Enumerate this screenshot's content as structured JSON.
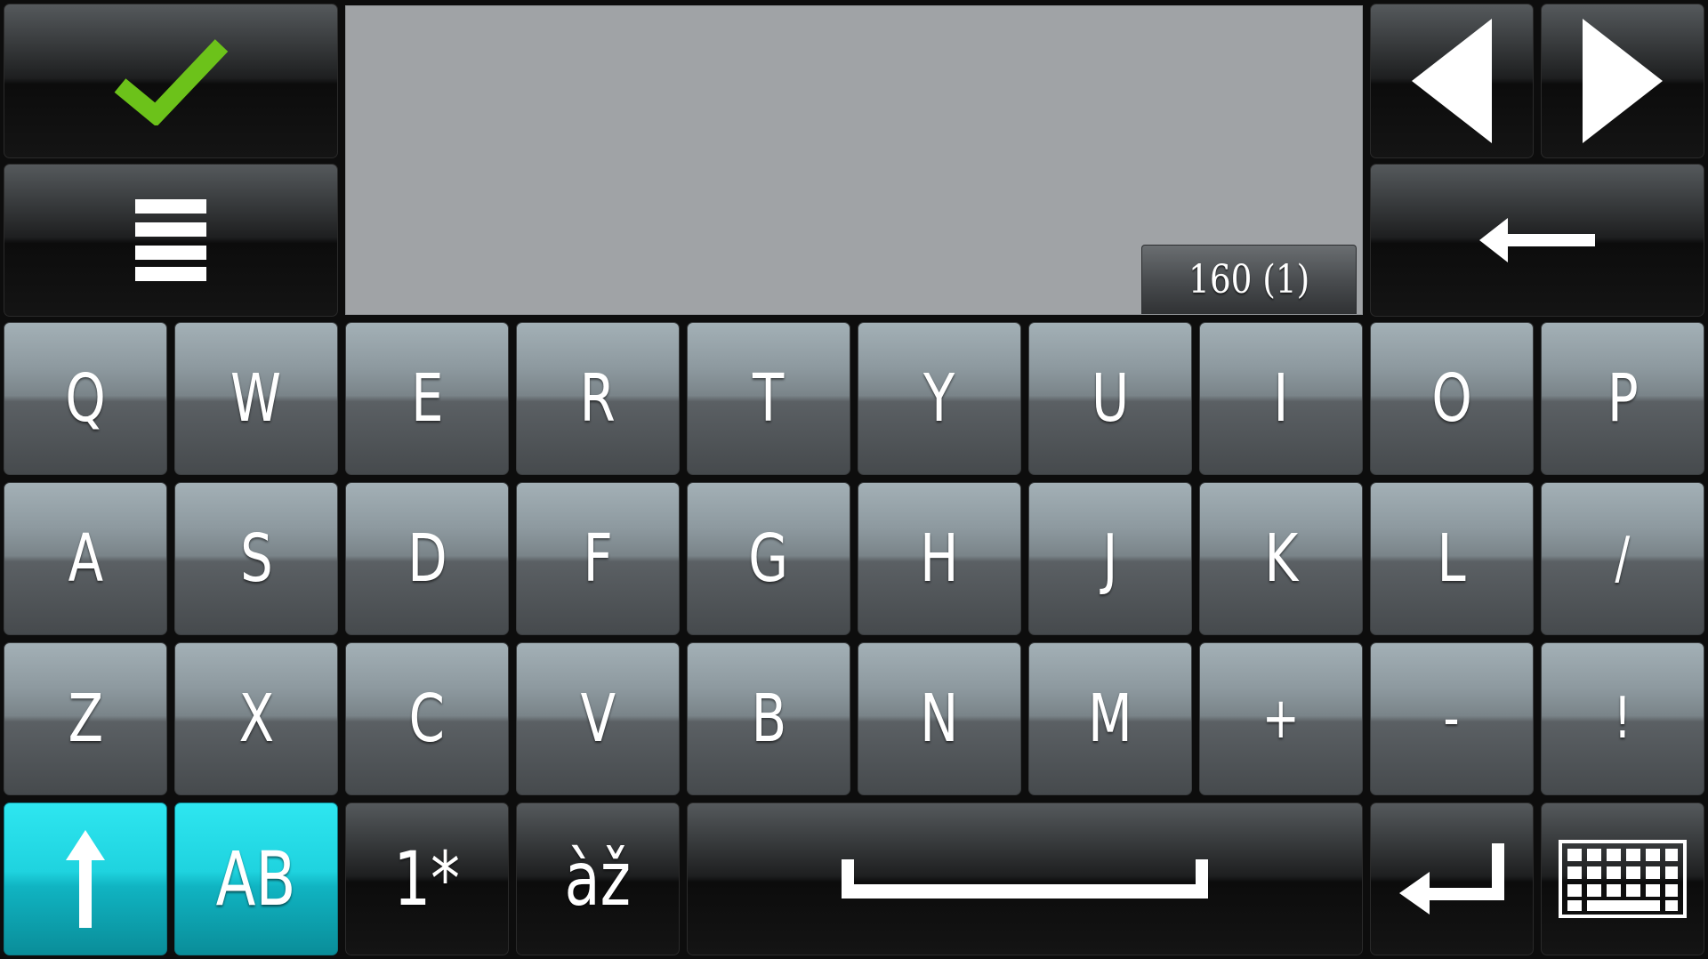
{
  "text_field": {
    "value": "",
    "char_counter": "160 (1)"
  },
  "keys": {
    "done_icon": "checkmark-icon",
    "menu_icon": "menu-icon",
    "cursor_left_icon": "triangle-left-icon",
    "cursor_right_icon": "triangle-right-icon",
    "backspace_icon": "backspace-arrow-icon",
    "shift_icon": "shift-arrow-icon",
    "enter_icon": "enter-icon",
    "space_icon": "space-bar-icon",
    "hide_keyboard_icon": "keyboard-icon",
    "mode_label": "AB",
    "numbers_label": "1*",
    "accents_label": "àž"
  },
  "rows": [
    [
      "Q",
      "W",
      "E",
      "R",
      "T",
      "Y",
      "U",
      "I",
      "O",
      "P"
    ],
    [
      "A",
      "S",
      "D",
      "F",
      "G",
      "H",
      "J",
      "K",
      "L",
      "/"
    ],
    [
      "Z",
      "X",
      "C",
      "V",
      "B",
      "N",
      "M",
      "+",
      "-",
      "!"
    ]
  ],
  "colors": {
    "accent": "#1fd3df",
    "check": "#6cc21a",
    "text_field_bg": "#a0a3a6"
  }
}
